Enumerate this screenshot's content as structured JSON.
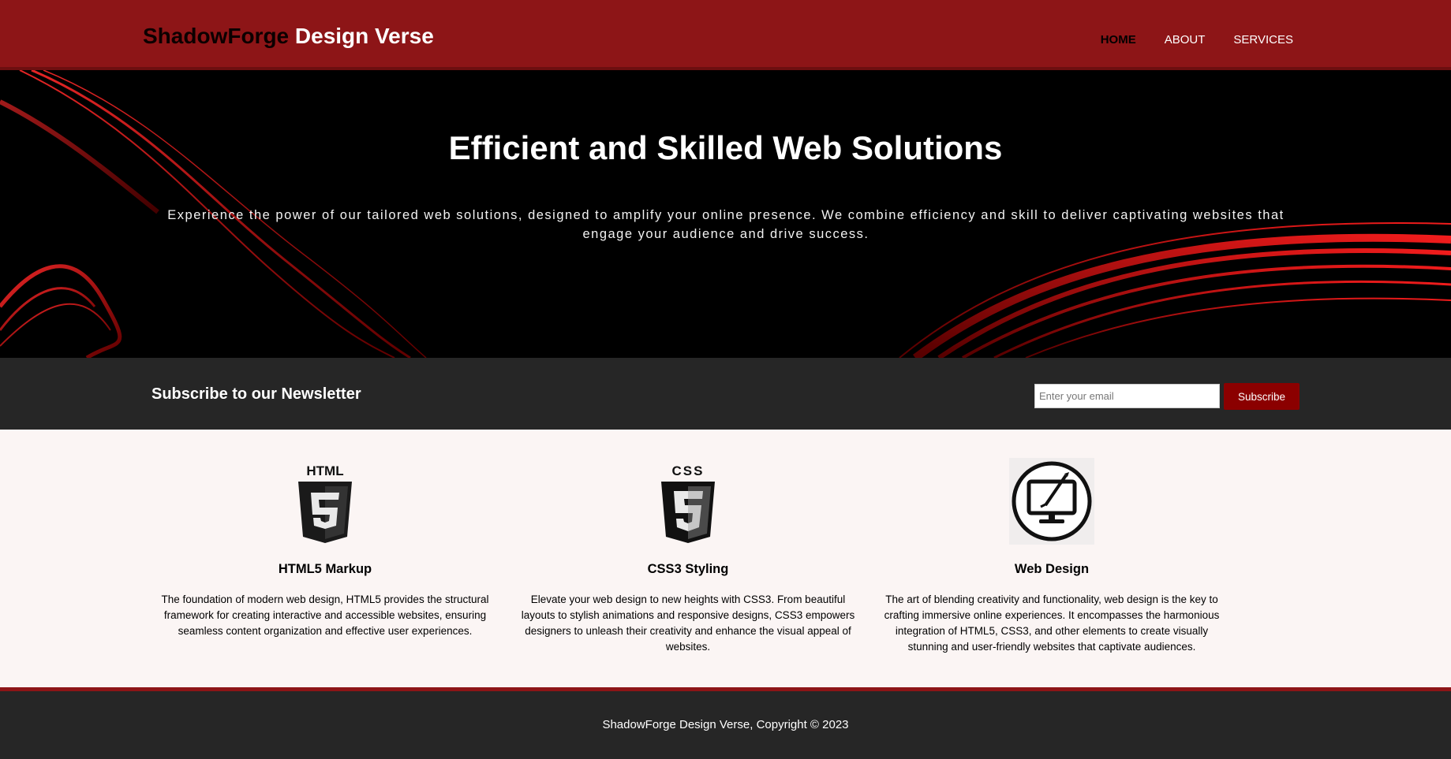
{
  "header": {
    "brand_part1": "ShadowForge",
    "brand_part2": "Design Verse",
    "nav": [
      {
        "label": "HOME",
        "active": true
      },
      {
        "label": "ABOUT",
        "active": false
      },
      {
        "label": "SERVICES",
        "active": false
      }
    ]
  },
  "hero": {
    "title": "Efficient and Skilled Web Solutions",
    "text": "Experience the power of our tailored web solutions, designed to amplify your online presence. We combine efficiency and skill to deliver captivating websites that engage your audience and drive success."
  },
  "newsletter": {
    "title": "Subscribe to our Newsletter",
    "email_placeholder": "Enter your email",
    "button_label": "Subscribe"
  },
  "features": [
    {
      "icon": "html5-icon",
      "title": "HTML5 Markup",
      "text": "The foundation of modern web design, HTML5 provides the structural framework for creating interactive and accessible websites, ensuring seamless content organization and effective user experiences."
    },
    {
      "icon": "css3-icon",
      "title": "CSS3 Styling",
      "text": "Elevate your web design to new heights with CSS3. From beautiful layouts to stylish animations and responsive designs, CSS3 empowers designers to unleash their creativity and enhance the visual appeal of websites."
    },
    {
      "icon": "web-design-icon",
      "title": "Web Design",
      "text": "The art of blending creativity and functionality, web design is the key to crafting immersive online experiences. It encompasses the harmonious integration of HTML5, CSS3, and other elements to create visually stunning and user-friendly websites that captivate audiences."
    }
  ],
  "footer": {
    "text": "ShadowForge Design Verse, Copyright © 2023"
  },
  "colors": {
    "header_bg": "#8d1517",
    "accent": "#8b0000",
    "dark_bg": "#262626",
    "hero_bg": "#000000",
    "content_bg": "#fbf5f4"
  }
}
